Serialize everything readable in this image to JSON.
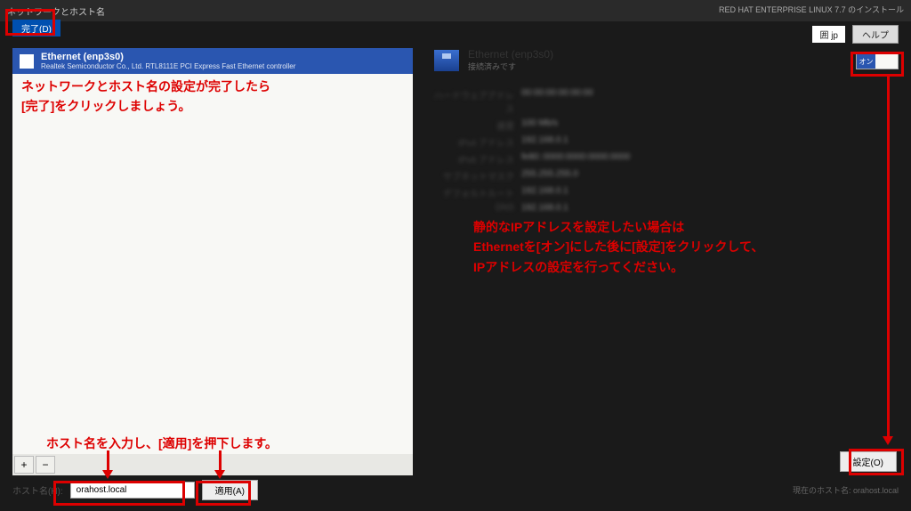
{
  "header": {
    "breadcrumb": "ネットワークとホスト名",
    "product": "RED HAT ENTERPRISE LINUX 7.7 のインストール",
    "lang": "囲 jp",
    "help_label": "ヘルプ",
    "done_label": "完了(D)"
  },
  "left": {
    "eth_title": "Ethernet (enp3s0)",
    "eth_sub": "Realtek Semiconductor Co., Ltd. RTL8111E PCI Express Fast Ethernet controller",
    "add_label": "+",
    "remove_label": "−"
  },
  "right": {
    "dev_name": "Ethernet (enp3s0)",
    "dev_status": "接続済みです",
    "toggle_on": "オン",
    "labels": {
      "hwaddr": "ハードウェアアドレス",
      "speed": "速度",
      "ipv4": "IPv4 アドレス",
      "ipv6": "IPv6 アドレス",
      "subnet": "サブネットマスク",
      "route": "デフォルトルート",
      "dns": "DNS"
    },
    "values": {
      "hwaddr": "00:00:00:00:00:00",
      "speed": "100 Mb/s",
      "ipv4": "192.168.0.1",
      "ipv6": "fe80::0000:0000:0000:0000",
      "subnet": "255.255.255.0",
      "route": "192.168.0.1",
      "dns": "192.168.0.1"
    },
    "config_label": "設定(O)"
  },
  "bottom": {
    "host_label": "ホスト名(H):",
    "host_value": "orahost.local",
    "apply_label": "適用(A)",
    "current_label": "現在のホスト名:",
    "current_value": "orahost.local"
  },
  "annotations": {
    "a1_l1": "ネットワークとホスト名の設定が完了したら",
    "a1_l2": "[完了]をクリックしましょう。",
    "a2_l1": "静的なIPアドレスを設定したい場合は",
    "a2_l2": "Ethernetを[オン]にした後に[設定]をクリックして、",
    "a2_l3": "IPアドレスの設定を行ってください。",
    "a3": "ホスト名を入力し、[適用]を押下します。"
  }
}
